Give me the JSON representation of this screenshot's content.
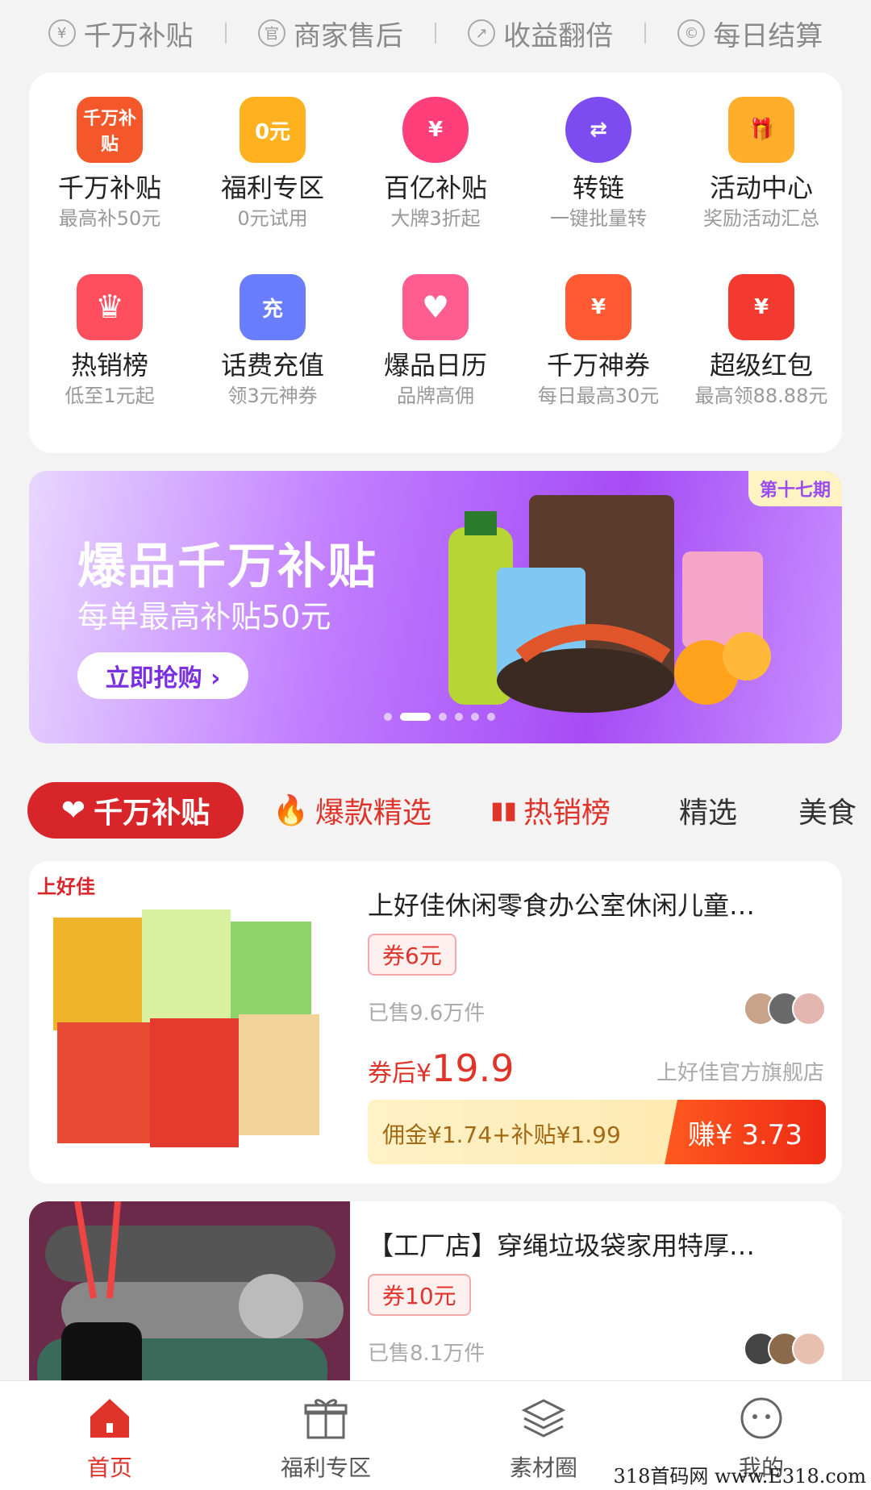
{
  "topbar": [
    {
      "icon": "¥",
      "label": "千万补贴"
    },
    {
      "icon": "官",
      "label": "商家售后"
    },
    {
      "icon": "↗",
      "label": "收益翻倍"
    },
    {
      "icon": "©",
      "label": "每日结算"
    }
  ],
  "grid": [
    {
      "title": "千万补贴",
      "sub": "最高补50元",
      "icon_text": "千万补贴",
      "color": "#f4572a"
    },
    {
      "title": "福利专区",
      "sub": "0元试用",
      "icon_text": "0元",
      "color": "#ffb21e"
    },
    {
      "title": "百亿补贴",
      "sub": "大牌3折起",
      "icon_text": "¥",
      "color": "#ff3f7a"
    },
    {
      "title": "转链",
      "sub": "一键批量转",
      "icon_text": "⇄",
      "color": "#7d4cf0"
    },
    {
      "title": "活动中心",
      "sub": "奖励活动汇总",
      "icon_text": "🎁",
      "color": "#ffae2b"
    },
    {
      "title": "热销榜",
      "sub": "低至1元起",
      "icon_text": "♛",
      "color": "#ff4f5e"
    },
    {
      "title": "话费充值",
      "sub": "领3元神券",
      "icon_text": "充",
      "color": "#6a7dff"
    },
    {
      "title": "爆品日历",
      "sub": "品牌高佣",
      "icon_text": "♥",
      "color": "#ff5c8f"
    },
    {
      "title": "千万神券",
      "sub": "每日最高30元",
      "icon_text": "¥",
      "color": "#ff5a33"
    },
    {
      "title": "超级红包",
      "sub": "最高领88.88元",
      "icon_text": "¥",
      "color": "#f23a30"
    }
  ],
  "banner": {
    "issue": "第十七期",
    "headline": "爆品千万补贴",
    "subline": "每单最高补贴50元",
    "button": "立即抢购 ›"
  },
  "tabs": [
    "千万补贴",
    "爆款精选",
    "热销榜",
    "精选",
    "美食"
  ],
  "products": [
    {
      "title": "上好佳休闲零食办公室休闲儿童…",
      "coupon": "券6元",
      "sold": "已售9.6万件",
      "price_prefix": "券后¥",
      "price": "19.9",
      "shop": "上好佳官方旗舰店",
      "commission": "佣金¥1.74+补贴¥1.99",
      "earn": "赚¥ 3.73",
      "brand": "上好佳"
    },
    {
      "title": "【工厂店】穿绳垃圾袋家用特厚…",
      "coupon": "券10元",
      "sold": "已售8.1万件"
    }
  ],
  "bottom_nav": [
    {
      "label": "首页",
      "icon": "home-icon"
    },
    {
      "label": "福利专区",
      "icon": "gift-icon"
    },
    {
      "label": "素材圈",
      "icon": "layers-icon"
    },
    {
      "label": "我的",
      "icon": "face-icon"
    }
  ],
  "watermark": "318首码网 www.E318.com",
  "colors": {
    "accent": "#e0332a",
    "banner": "#a64cf5",
    "earn": "#ee2a16"
  }
}
